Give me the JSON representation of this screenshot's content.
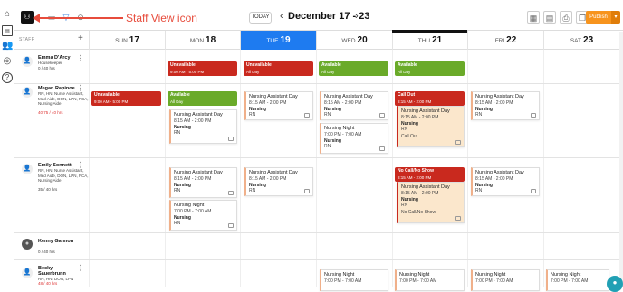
{
  "sidebar": {
    "icons": [
      "home-icon",
      "calendar-icon",
      "people-icon",
      "location-icon",
      "help-icon"
    ]
  },
  "toolbar": {
    "annotation": "Staff View icon",
    "today_label": "TODAY",
    "prev": "‹",
    "next": "›",
    "date_range": "December 17 - 23",
    "publish_label": "Publish",
    "publish_caret": "▾"
  },
  "header": {
    "staff_label": "STAFF",
    "add_label": "+",
    "days": [
      {
        "dow": "SUN",
        "num": "17"
      },
      {
        "dow": "MON",
        "num": "18"
      },
      {
        "dow": "TUE",
        "num": "19"
      },
      {
        "dow": "WED",
        "num": "20"
      },
      {
        "dow": "THU",
        "num": "21"
      },
      {
        "dow": "FRI",
        "num": "22"
      },
      {
        "dow": "SAT",
        "num": "23"
      }
    ]
  },
  "staff": [
    {
      "name": "Emma D'Arcy",
      "desc": "Housekeeper",
      "hours": "0 / 40 hrs"
    },
    {
      "name": "Megan Rapinoe",
      "desc": "RN, HN, Nurse Assistant, Med Aide, DON, LPN, PCA, Nursing Aide",
      "hours": "40.75 / 40 hrs"
    },
    {
      "name": "Emily Sonnett",
      "desc": "RN, HN, Nurse Assistant, Med Aide, DON, LPN, PCA, Nursing Aide",
      "hours": "35 / 40 hrs"
    },
    {
      "name": "Kenny Gannon",
      "desc": "",
      "hours": "0 / 40 hrs"
    },
    {
      "name": "Becky Sauerbrunn",
      "desc": "RN, HN, DON, LPN",
      "hours": "48 / 40 hrs"
    }
  ],
  "badges": {
    "unavailable": "Unavailable",
    "available": "Available",
    "call_out": "Call Out",
    "no_call": "No Call/No Show",
    "time_9_5": "9:00 AM - 5:00 PM",
    "all_day": "All Day",
    "time_8_2": "8:15 AM - 2:00 PM"
  },
  "shifts": {
    "nad": "Nursing Assistant Day",
    "nn": "Nursing Night",
    "t_day": "8:15 AM - 2:00 PM",
    "t_night": "7:00 PM - 7:00 AM",
    "role": "RN",
    "area": "Nursing",
    "call_out_note": "Call Out",
    "no_call_note": "No Call/No Show"
  },
  "colors": {
    "accent": "#1e7bf0",
    "publish": "#f7941d",
    "danger": "#c9291e",
    "success": "#6aaa29",
    "annotation": "#e74c3c"
  }
}
